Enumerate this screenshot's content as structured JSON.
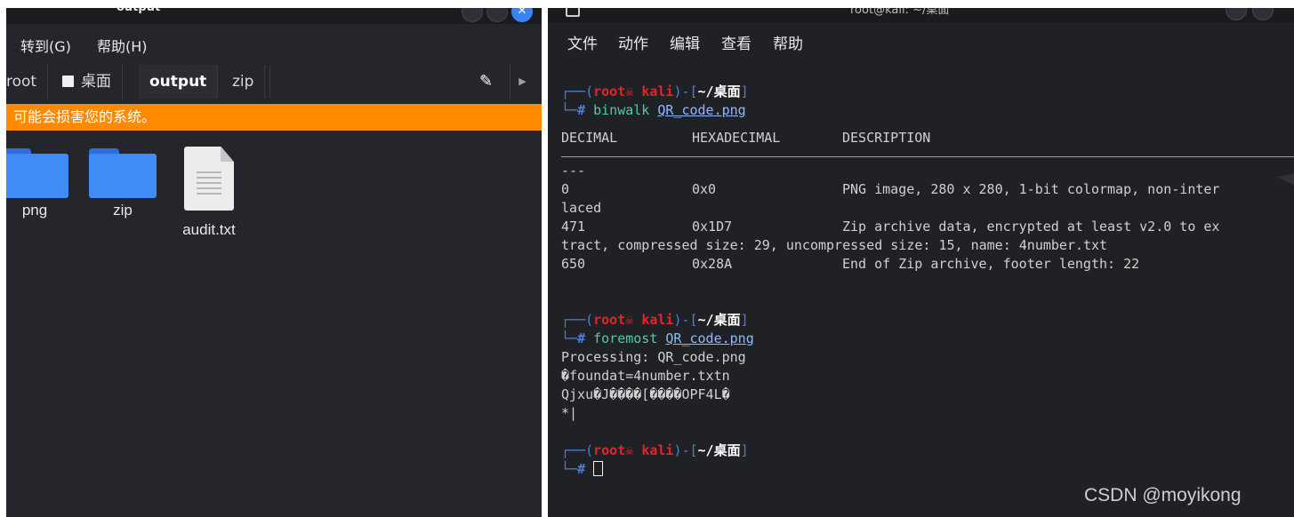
{
  "file_manager": {
    "title": "output",
    "menu": [
      "转到(G)",
      "帮助(H)"
    ],
    "tabs": [
      "root",
      "桌面",
      "output",
      "zip"
    ],
    "warning": "可能会损害您的系统。",
    "files": [
      {
        "name": "png",
        "icon": "folder-icon"
      },
      {
        "name": "zip",
        "icon": "folder-icon"
      },
      {
        "name": "audit.txt",
        "icon": "text-file-icon"
      }
    ]
  },
  "terminal": {
    "title": "root@kali: ~/桌面",
    "menu": [
      "文件",
      "动作",
      "编辑",
      "查看",
      "帮助"
    ],
    "prompt": {
      "user": "root",
      "host": "kali",
      "path": "~/桌面"
    },
    "commands": [
      {
        "cmd": "binwalk",
        "arg": "QR_code.png"
      },
      {
        "cmd": "foremost",
        "arg": "QR_code.png"
      }
    ],
    "binwalk_header": [
      "DECIMAL",
      "HEXADECIMAL",
      "DESCRIPTION"
    ],
    "binwalk_sep": "---",
    "binwalk_rows": [
      {
        "dec": "0",
        "hex": "0x0",
        "desc": "PNG image, 280 x 280, 1-bit colormap, non-inter",
        "cont": "laced"
      },
      {
        "dec": "471",
        "hex": "0x1D7",
        "desc": "Zip archive data, encrypted at least v2.0 to ex",
        "cont": "tract, compressed size: 29, uncompressed size: 15, name: 4number.txt"
      },
      {
        "dec": "650",
        "hex": "0x28A",
        "desc": "End of Zip archive, footer length: 22",
        "cont": ""
      }
    ],
    "foremost_output": [
      "Processing: QR_code.png",
      "�foundat=4number.txtn",
      "Qjxu�J����[����OPF4L�",
      "*|"
    ]
  },
  "watermark": "CSDN @moyikong"
}
